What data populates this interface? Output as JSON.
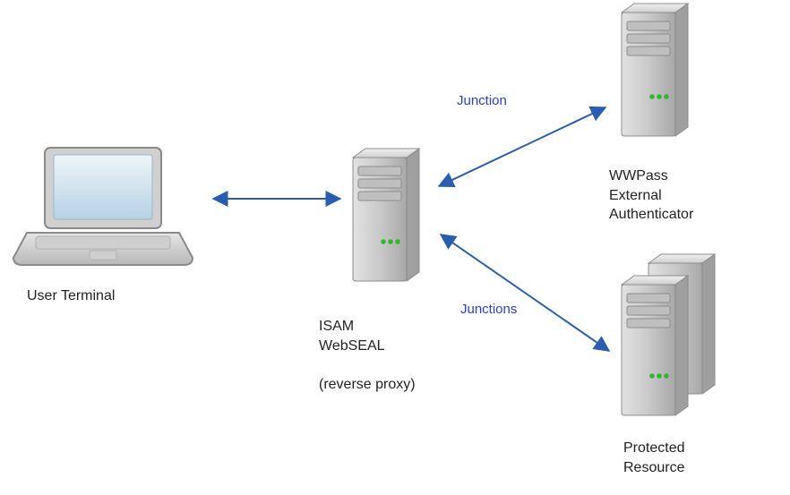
{
  "diagram": {
    "type": "network-architecture",
    "nodes": {
      "user_terminal": {
        "label": "User Terminal",
        "icon": "laptop"
      },
      "isam": {
        "label": "ISAM\nWebSEAL\n\n(reverse proxy)",
        "icon": "server"
      },
      "wwpass": {
        "label": "WWPass\nExternal\nAuthenticator",
        "icon": "server"
      },
      "protected": {
        "label": "Protected\nResource",
        "icon": "server-cluster"
      }
    },
    "edges": [
      {
        "from": "user_terminal",
        "to": "isam",
        "label": "",
        "bidirectional": true
      },
      {
        "from": "isam",
        "to": "wwpass",
        "label": "Junction",
        "bidirectional": true
      },
      {
        "from": "isam",
        "to": "protected",
        "label": "Junctions",
        "bidirectional": true
      }
    ],
    "edge_labels": {
      "junction": "Junction",
      "junctions": "Junctions"
    },
    "colors": {
      "arrow": "#2a5db0",
      "edge_label": "#2a3dc9",
      "server_body_light": "#d7d7d7",
      "server_body_dark": "#a8a8a8",
      "server_led": "#2fb82f",
      "laptop_screen": "#cfe3ef"
    }
  }
}
